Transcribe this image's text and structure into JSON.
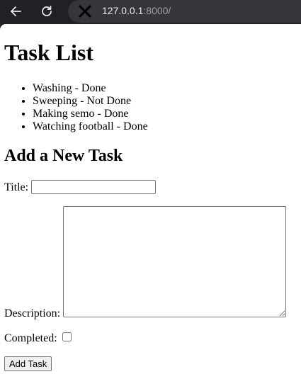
{
  "browser": {
    "url_host": "127.0.0.1",
    "url_rest": ":8000/"
  },
  "page": {
    "title": "Task List",
    "tasks": [
      "Washing - Done",
      "Sweeping - Not Done",
      "Making semo - Done",
      "Watching football - Done"
    ],
    "form": {
      "heading": "Add a New Task",
      "title_label": "Title:",
      "title_value": "",
      "description_label": "Description:",
      "description_value": "",
      "completed_label": "Completed:",
      "submit_label": "Add Task"
    }
  }
}
